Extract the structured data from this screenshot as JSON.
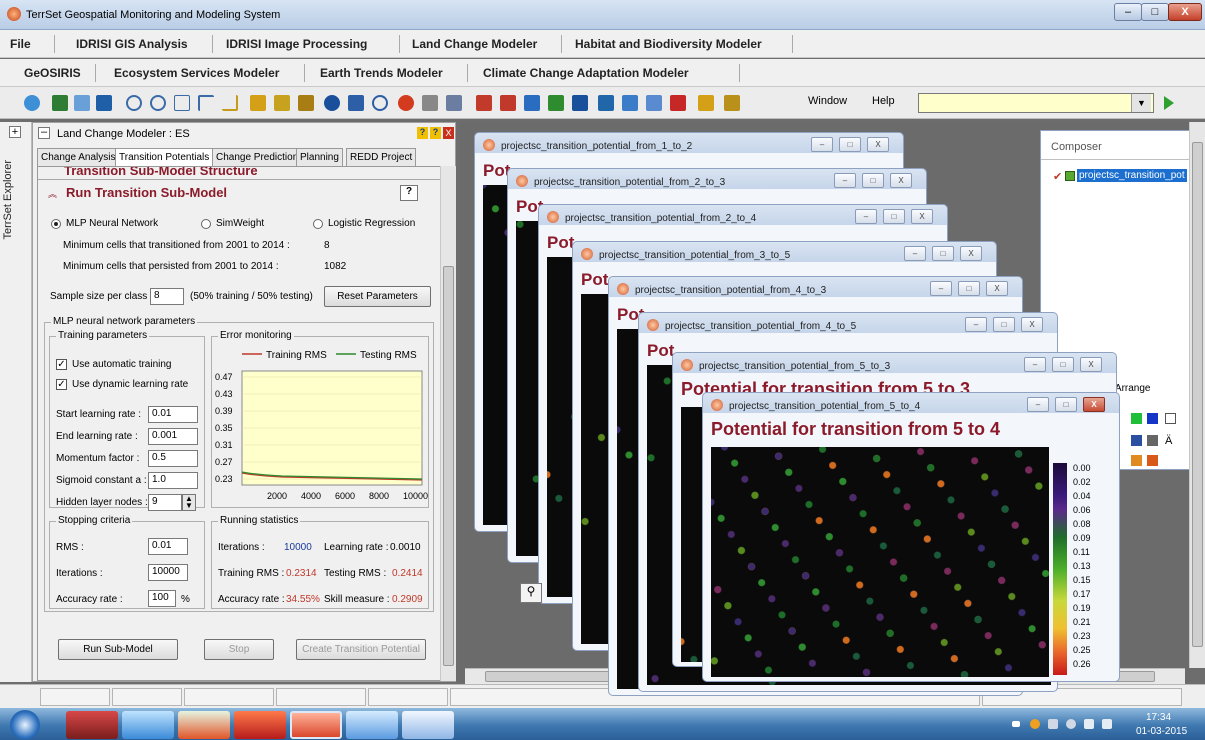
{
  "window": {
    "title": "TerrSet Geospatial Monitoring and Modeling System",
    "min": "–",
    "max": "□",
    "close": "X"
  },
  "menu1": [
    "File",
    "IDRISI GIS Analysis",
    "IDRISI Image Processing",
    "Land Change Modeler",
    "Habitat and Biodiversity Modeler"
  ],
  "menu2": [
    "GeOSIRIS",
    "Ecosystem Services Modeler",
    "Earth Trends Modeler",
    "Climate Change Adaptation Modeler"
  ],
  "toolbar": {
    "window_label": "Window",
    "help_label": "Help",
    "combo_value": "",
    "combo_arrow": "▼"
  },
  "explorer": {
    "label": "TerrSet Explorer"
  },
  "lcm": {
    "title": "Land Change Modeler : ES",
    "tree_toggle": "+",
    "collapse": "–",
    "help": "?",
    "tabs": [
      "Change Analysis",
      "Transition Potentials",
      "Change Prediction",
      "Planning",
      "REDD Project"
    ],
    "prev_section": "Transition Sub-Model Structure",
    "section": "Run Transition Sub-Model",
    "section_help": "?",
    "methods": {
      "mlp": "MLP Neural Network",
      "simweight": "SimWeight",
      "logistic": "Logistic Regression"
    },
    "min_transitioned_label": "Minimum cells that transitioned from 2001 to 2014 :",
    "min_transitioned_value": "8",
    "min_persisted_label": "Minimum cells that persisted from 2001 to 2014 :",
    "min_persisted_value": "1082",
    "sample_label": "Sample size per class :",
    "sample_value": "8",
    "sample_note": "(50% training / 50% testing)",
    "reset_button": "Reset Parameters",
    "mlp_params_title": "MLP neural network parameters",
    "training": {
      "title": "Training parameters",
      "auto": "Use automatic training",
      "dynamic": "Use dynamic learning rate",
      "start_lr_label": "Start learning rate :",
      "start_lr": "0.01",
      "end_lr_label": "End learning rate :",
      "end_lr": "0.001",
      "momentum_label": "Momentum factor :",
      "momentum": "0.5",
      "sigmoid_label": "Sigmoid constant a :",
      "sigmoid": "1.0",
      "hidden_label": "Hidden layer nodes :",
      "hidden": "9",
      "check": "✓"
    },
    "error": {
      "title": "Error monitoring",
      "legend_train": "Training RMS",
      "legend_test": "Testing RMS",
      "yticks": [
        "0.47",
        "0.43",
        "0.39",
        "0.35",
        "0.31",
        "0.27",
        "0.23"
      ],
      "xticks": [
        "2000",
        "4000",
        "6000",
        "8000",
        "10000"
      ]
    },
    "stopping": {
      "title": "Stopping criteria",
      "rms_label": "RMS :",
      "rms": "0.01",
      "iter_label": "Iterations :",
      "iter": "10000",
      "acc_label": "Accuracy rate :",
      "acc": "100",
      "pct": "%"
    },
    "running": {
      "title": "Running statistics",
      "iter_label": "Iterations :",
      "iter": "10000",
      "lr_label": "Learning rate :",
      "lr": "0.0010",
      "trms_label": "Training RMS :",
      "trms": "0.2314",
      "tstrms_label": "Testing RMS :",
      "tstrms": "0.2414",
      "acc_label": "Accuracy rate :",
      "acc": "34.55%",
      "skill_label": "Skill measure :",
      "skill": "0.2909"
    },
    "run_button": "Run Sub-Model",
    "stop_button": "Stop",
    "create_button": "Create Transition Potential"
  },
  "map_windows": [
    {
      "title": "projectsc_transition_potential_from_1_to_2",
      "heading": "Pot"
    },
    {
      "title": "projectsc_transition_potential_from_2_to_3",
      "heading": "Pot"
    },
    {
      "title": "projectsc_transition_potential_from_2_to_4",
      "heading": "Pot"
    },
    {
      "title": "projectsc_transition_potential_from_3_to_5",
      "heading": "Pot"
    },
    {
      "title": "projectsc_transition_potential_from_4_to_3",
      "heading": "Pot"
    },
    {
      "title": "projectsc_transition_potential_from_4_to_5",
      "heading": "Pot"
    },
    {
      "title": "projectsc_transition_potential_from_5_to_3",
      "heading": "Potential for transition from 5 to 3"
    },
    {
      "title": "projectsc_transition_potential_from_5_to_4",
      "heading": "Potential for transition from 5 to 4"
    }
  ],
  "legend_values": [
    "0.00",
    "0.02",
    "0.04",
    "0.06",
    "0.08",
    "0.09",
    "0.11",
    "0.13",
    "0.15",
    "0.17",
    "0.19",
    "0.21",
    "0.23",
    "0.25",
    "0.26"
  ],
  "composer": {
    "title": "Composer",
    "layer": "projectsc_transition_pot",
    "auto_arrange": "Auto-Arrange"
  },
  "clock": {
    "time": "17:34",
    "date": "01-03-2015"
  },
  "colors": {
    "heading": "#8b1a2a",
    "title_bar": "#b9cde6",
    "taskbar": "#3f78b0",
    "training_line": "#c0392b",
    "testing_line": "#2e8b2e",
    "chart_bg": "#ffffcc"
  }
}
